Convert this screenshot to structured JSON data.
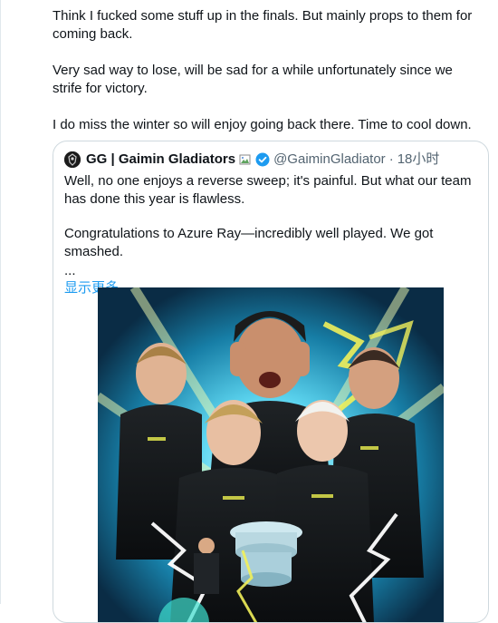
{
  "tweet": {
    "paragraphs": [
      "Think I fucked some stuff up in the finals. But mainly props to them for coming back.",
      "Very sad way to lose, will be sad for a while unfortunately since we strife for victory.",
      "I do miss the winter so will enjoy going back there. Time to cool down."
    ]
  },
  "quote": {
    "display_name": "GG | Gaimin Gladiators",
    "handle": "@GaiminGladiator",
    "separator": "·",
    "time": "18小时",
    "text_1": "Well, no one enjoys a reverse sweep; it's painful. But what our team has done this year is flawless.",
    "text_2": "Congratulations to Azure Ray—incredibly well played. We got smashed.",
    "ellipsis": "...",
    "show_more": "显示更多",
    "media_description_icon": "team-photo"
  },
  "colors": {
    "text": "#0f1419",
    "secondary": "#536471",
    "link": "#1d9bf0",
    "border": "#cfd9de"
  }
}
